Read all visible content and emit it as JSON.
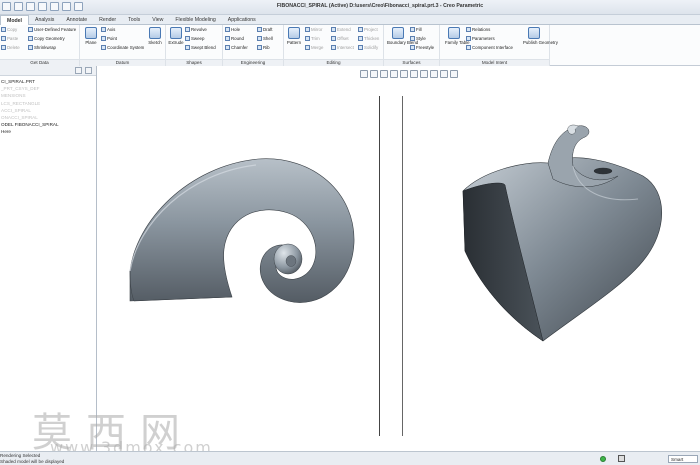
{
  "window": {
    "title": "FIBONACCI_SPIRAL (Active) D:\\users\\Creo\\Fibonacci_spiral.prt.3 - Creo Parametric"
  },
  "ribbon_tabs": [
    "Model",
    "Analysis",
    "Annotate",
    "Render",
    "Tools",
    "View",
    "Flexible Modeling",
    "Applications"
  ],
  "ribbon": {
    "get_data": {
      "label": "Get Data",
      "items": [
        "User-Defined Feature",
        "Copy Geometry",
        "Shrinkwrap"
      ],
      "left_items": [
        "Copy",
        "Paste",
        "Delete"
      ]
    },
    "datum": {
      "label": "Datum",
      "plane": "Plane",
      "items": [
        "Axis",
        "Point",
        "Coordinate System"
      ],
      "sketch": "Sketch"
    },
    "shapes": {
      "label": "Shapes",
      "extrude": "Extrude",
      "items": [
        "Revolve",
        "Sweep",
        "Swept Blend"
      ]
    },
    "engineering": {
      "label": "Engineering",
      "col1": [
        "Hole",
        "Round",
        "Chamfer"
      ],
      "col2": [
        "Draft",
        "Shell",
        "Rib"
      ]
    },
    "editing": {
      "label": "Editing",
      "pattern": "Pattern",
      "col1": [
        "Mirror",
        "Trim",
        "Merge"
      ],
      "col2": [
        "Extend",
        "Offset",
        "Intersect"
      ],
      "col3": [
        "Project",
        "Thicken",
        "Solidify"
      ]
    },
    "surfaces": {
      "label": "Surfaces",
      "boundary": "Boundary Blend",
      "items": [
        "Fill",
        "Style",
        "Freestyle"
      ]
    },
    "model_intent": {
      "label": "Model Intent",
      "family_table": "Family Table",
      "items": [
        "Relations",
        "Parameters",
        "Component Interface"
      ],
      "publish": "Publish Geometry"
    }
  },
  "model_tree": {
    "header": "",
    "items": [
      {
        "text": "",
        "dim": false
      },
      {
        "text": "CI_SPIRAL.PRT",
        "dim": false
      },
      {
        "text": "",
        "dim": false
      },
      {
        "text": "",
        "dim": false
      },
      {
        "text": "_PRT_CSYS_DEF",
        "dim": true
      },
      {
        "text": "",
        "dim": false
      },
      {
        "text": "",
        "dim": true
      },
      {
        "text": "",
        "dim": true
      },
      {
        "text": "MENSIONS",
        "dim": true
      },
      {
        "text": "LCS_RECTANGLE",
        "dim": true
      },
      {
        "text": "ACCI_SPIRAL",
        "dim": true
      },
      {
        "text": "",
        "dim": true
      },
      {
        "text": "",
        "dim": true
      },
      {
        "text": "",
        "dim": true
      },
      {
        "text": "ONACCI_SPIRAL",
        "dim": true
      },
      {
        "text": "ODEL FIBONACCI_SPIRAL",
        "dim": false
      },
      {
        "text": "Here",
        "dim": false
      }
    ]
  },
  "status": {
    "line1": "Rendering Selected",
    "line2": "Shaded model will be displayed",
    "filter": "Smart"
  },
  "watermark": {
    "chinese": "莫西网",
    "url": "www.3dmox.com"
  },
  "colors": {
    "model_shade": "#7a8690",
    "model_highlight": "#c7cfd6",
    "model_dark": "#2e3338"
  }
}
